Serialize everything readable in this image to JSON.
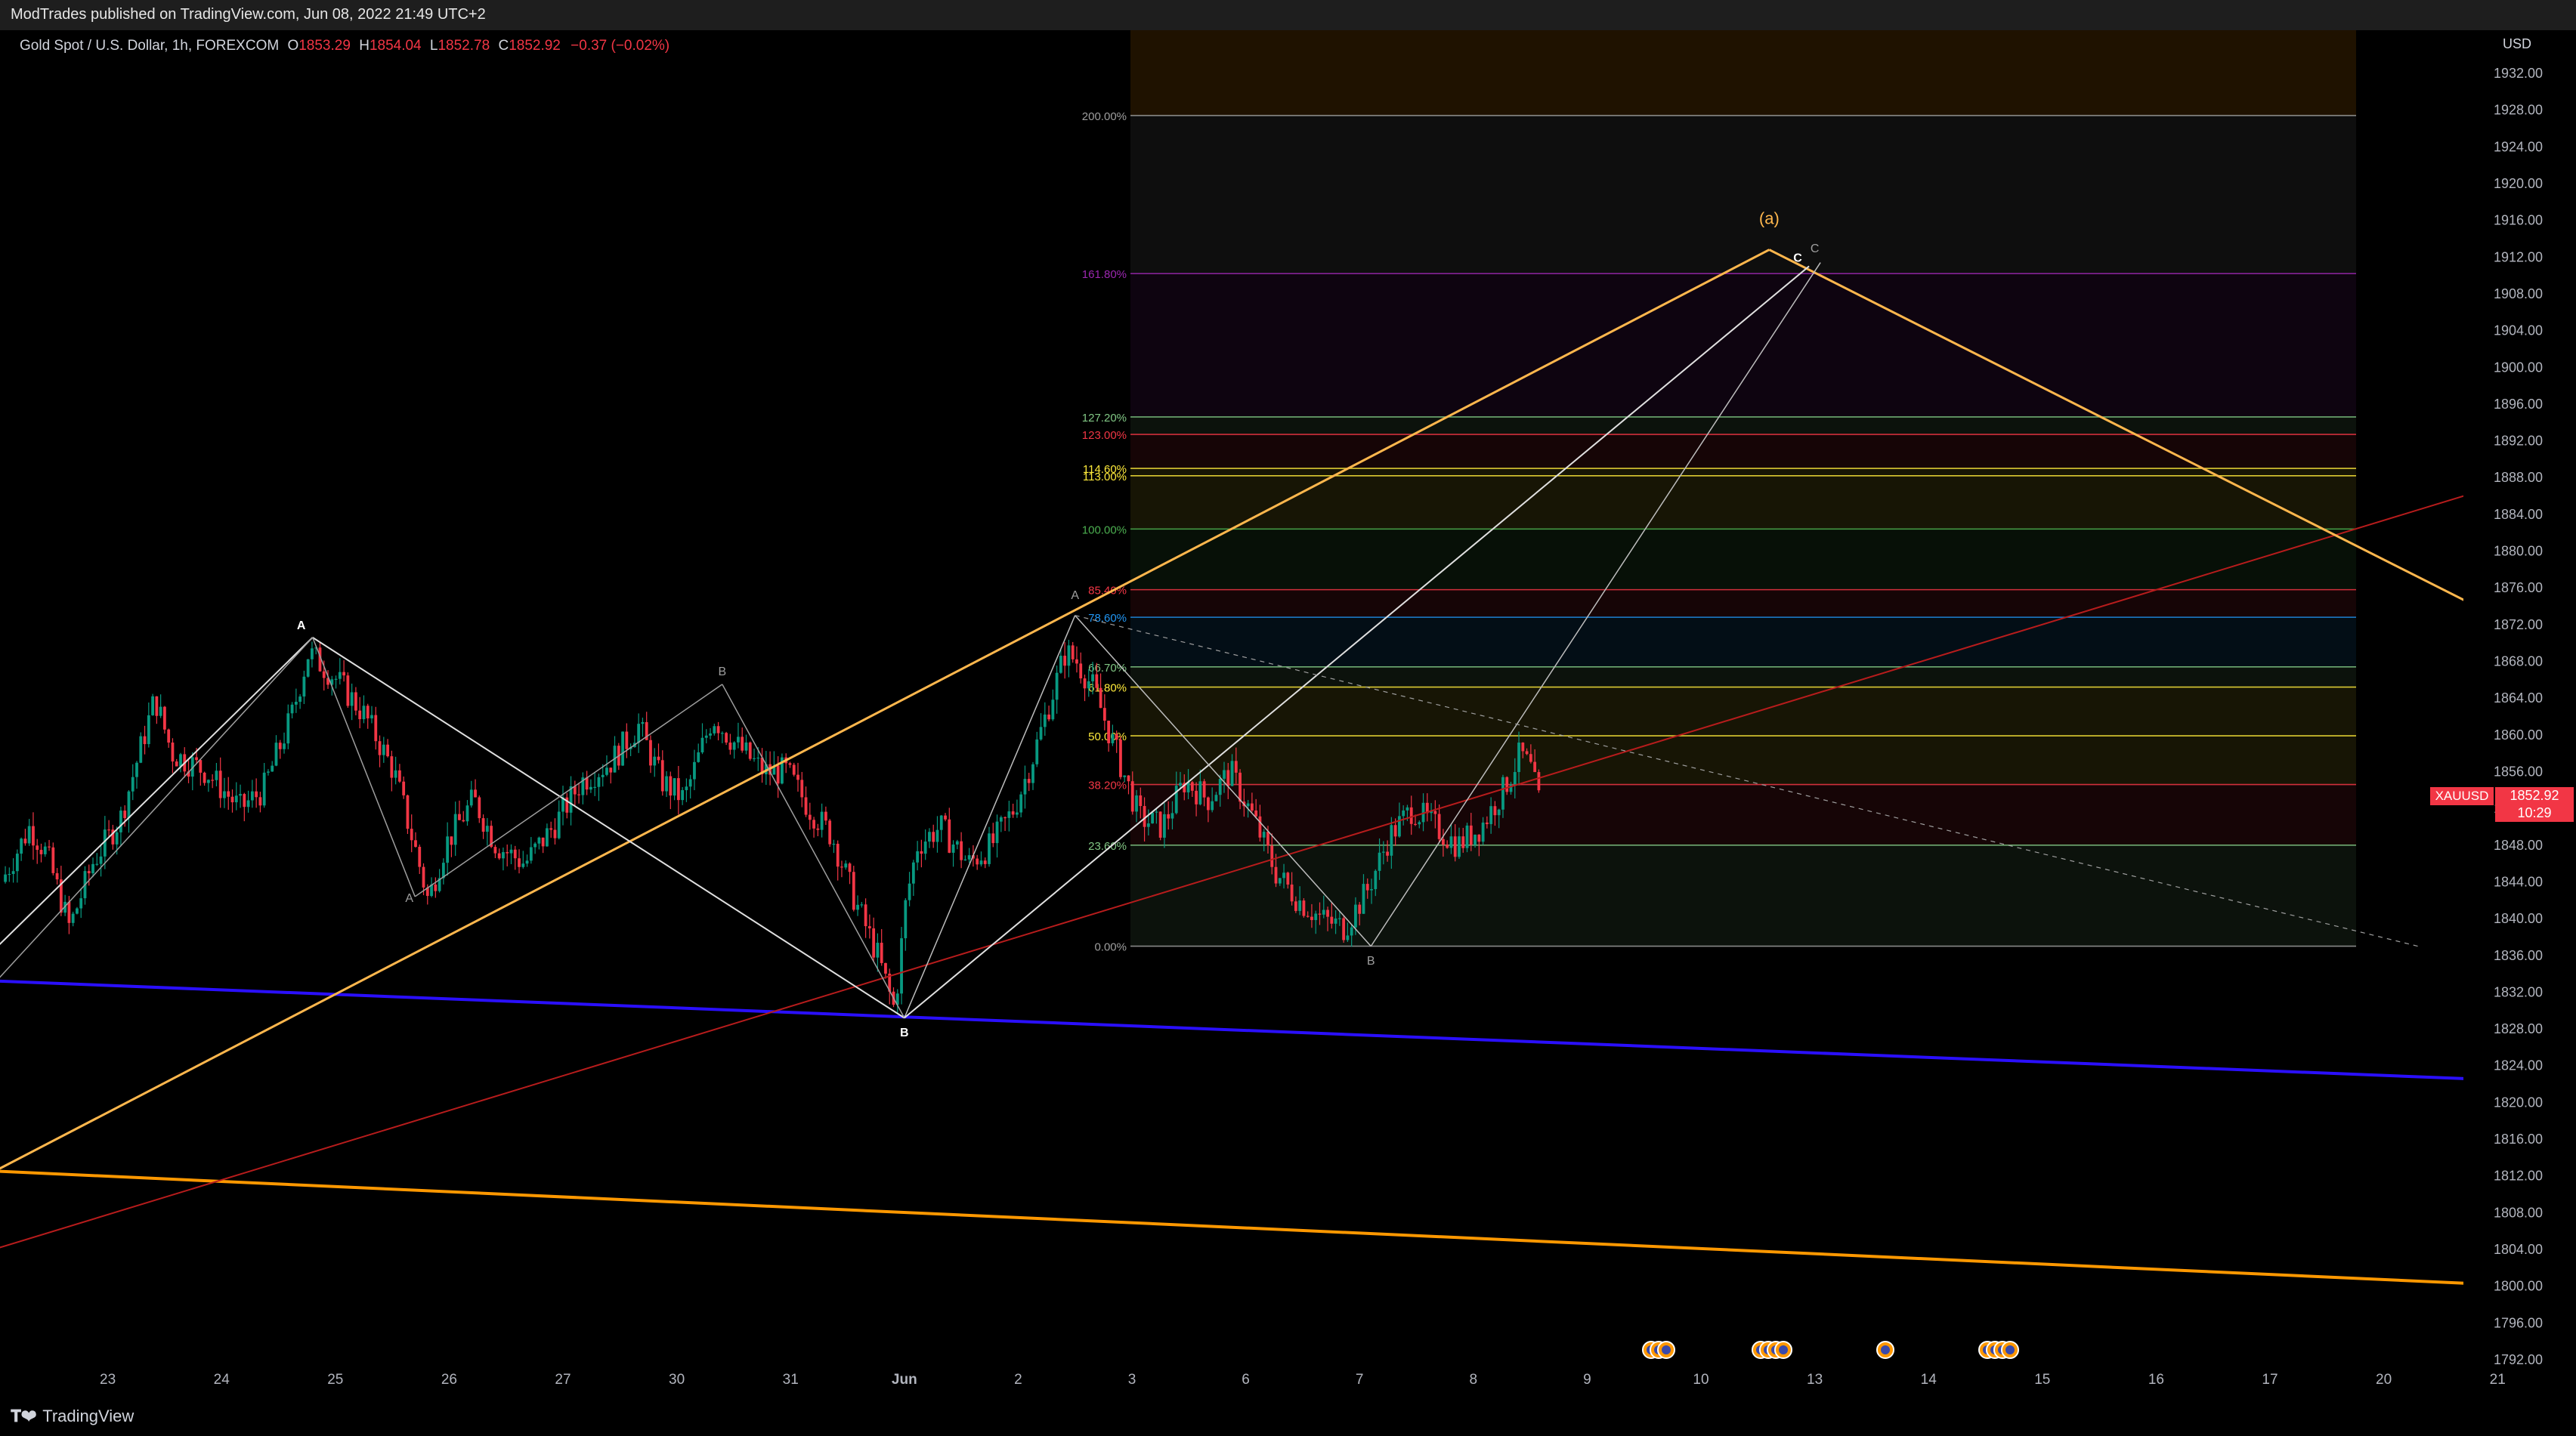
{
  "header": {
    "published": "ModTrades published on TradingView.com, Jun 08, 2022 21:49 UTC+2"
  },
  "legend": {
    "title": "Gold Spot / U.S. Dollar, 1h, FOREXCOM",
    "o_label": "O",
    "o_value": "1853.29",
    "h_label": "H",
    "h_value": "1854.04",
    "l_label": "L",
    "l_value": "1852.78",
    "c_label": "C",
    "c_value": "1852.92",
    "change": "−0.37 (−0.02%)"
  },
  "axis": {
    "currency": "USD",
    "symbol": "XAUUSD",
    "last_price": "1852.92",
    "countdown": "10:29"
  },
  "footer": {
    "brand": "TradingView"
  },
  "colors": {
    "background": "#000000",
    "up_candle": "#089981",
    "down_candle": "#f23645",
    "orange_line": "#ffb74d",
    "blue_line": "#2a0fff",
    "red_line": "#b71c1c",
    "white_line": "#e0e0e0"
  },
  "chart_data": {
    "type": "line",
    "title": "Gold Spot / U.S. Dollar, 1h, FOREXCOM",
    "xlabel": "",
    "ylabel": "",
    "ylim": [
      1790,
      1934
    ],
    "y_ticks": [
      1792,
      1796,
      1800,
      1804,
      1808,
      1812,
      1816,
      1820,
      1824,
      1828,
      1832,
      1836,
      1840,
      1844,
      1848,
      1852,
      1856,
      1860,
      1864,
      1868,
      1872,
      1876,
      1880,
      1884,
      1888,
      1892,
      1896,
      1900,
      1904,
      1908,
      1912,
      1916,
      1920,
      1924,
      1928,
      1932
    ],
    "x_ticks": [
      {
        "label": "23",
        "x": 1
      },
      {
        "label": "24",
        "x": 2
      },
      {
        "label": "25",
        "x": 3
      },
      {
        "label": "26",
        "x": 4
      },
      {
        "label": "27",
        "x": 5
      },
      {
        "label": "30",
        "x": 6
      },
      {
        "label": "31",
        "x": 7
      },
      {
        "label": "Jun",
        "x": 8,
        "bold": true
      },
      {
        "label": "2",
        "x": 9
      },
      {
        "label": "3",
        "x": 10
      },
      {
        "label": "6",
        "x": 11
      },
      {
        "label": "7",
        "x": 12
      },
      {
        "label": "8",
        "x": 13
      },
      {
        "label": "9",
        "x": 14
      },
      {
        "label": "10",
        "x": 15
      },
      {
        "label": "13",
        "x": 16
      },
      {
        "label": "14",
        "x": 17
      },
      {
        "label": "15",
        "x": 18
      },
      {
        "label": "16",
        "x": 19
      },
      {
        "label": "17",
        "x": 20
      },
      {
        "label": "20",
        "x": 21
      },
      {
        "label": "21",
        "x": 22
      }
    ],
    "price_series": {
      "name": "XAUUSD",
      "points": [
        [
          0.1,
          1844
        ],
        [
          0.35,
          1850
        ],
        [
          0.5,
          1847
        ],
        [
          0.7,
          1839
        ],
        [
          0.9,
          1846
        ],
        [
          1.15,
          1851
        ],
        [
          1.45,
          1864
        ],
        [
          1.6,
          1858
        ],
        [
          1.9,
          1856
        ],
        [
          2.2,
          1852
        ],
        [
          2.4,
          1854
        ],
        [
          2.65,
          1862
        ],
        [
          2.8,
          1869
        ],
        [
          3.05,
          1866
        ],
        [
          3.3,
          1862
        ],
        [
          3.55,
          1856
        ],
        [
          3.75,
          1847
        ],
        [
          3.85,
          1842
        ],
        [
          4.0,
          1848
        ],
        [
          4.25,
          1853
        ],
        [
          4.45,
          1848
        ],
        [
          4.7,
          1846
        ],
        [
          4.95,
          1850
        ],
        [
          5.2,
          1855
        ],
        [
          5.45,
          1857
        ],
        [
          5.7,
          1861
        ],
        [
          5.9,
          1855
        ],
        [
          6.1,
          1853
        ],
        [
          6.35,
          1862
        ],
        [
          6.55,
          1859
        ],
        [
          6.8,
          1856
        ],
        [
          7.0,
          1856
        ],
        [
          7.2,
          1852
        ],
        [
          7.4,
          1849
        ],
        [
          7.6,
          1842
        ],
        [
          7.8,
          1836
        ],
        [
          7.95,
          1830
        ],
        [
          8.05,
          1842
        ],
        [
          8.15,
          1848
        ],
        [
          8.35,
          1850
        ],
        [
          8.6,
          1846
        ],
        [
          8.8,
          1848
        ],
        [
          9.0,
          1852
        ],
        [
          9.15,
          1857
        ],
        [
          9.3,
          1863
        ],
        [
          9.45,
          1869
        ],
        [
          9.55,
          1868
        ],
        [
          9.7,
          1865
        ],
        [
          9.9,
          1858
        ],
        [
          10.1,
          1851
        ],
        [
          10.3,
          1850
        ],
        [
          10.5,
          1855
        ],
        [
          10.7,
          1853
        ],
        [
          10.9,
          1856
        ],
        [
          11.1,
          1851
        ],
        [
          11.3,
          1845
        ],
        [
          11.5,
          1842
        ],
        [
          11.7,
          1840
        ],
        [
          11.9,
          1839
        ],
        [
          12.1,
          1843
        ],
        [
          12.3,
          1849
        ],
        [
          12.5,
          1852
        ],
        [
          12.7,
          1850
        ],
        [
          12.9,
          1848
        ],
        [
          13.1,
          1850
        ],
        [
          13.3,
          1854
        ],
        [
          13.45,
          1858
        ],
        [
          13.55,
          1856
        ],
        [
          13.6,
          1852.9
        ]
      ]
    },
    "fib_retracement": {
      "levels": [
        {
          "label": "0.00%",
          "price": 1837.0,
          "color": "#9e9e9e"
        },
        {
          "label": "23.60%",
          "price": 1848.0,
          "color": "#81c784"
        },
        {
          "label": "38.20%",
          "price": 1854.6,
          "color": "#f23645"
        },
        {
          "label": "50.00%",
          "price": 1859.9,
          "color": "#ffeb3b"
        },
        {
          "label": "61.80%",
          "price": 1865.2,
          "color": "#ffeb3b"
        },
        {
          "label": "66.70%",
          "price": 1867.4,
          "color": "#81c784"
        },
        {
          "label": "78.60%",
          "price": 1872.8,
          "color": "#2196f3"
        },
        {
          "label": "85.40%",
          "price": 1875.8,
          "color": "#f23645"
        },
        {
          "label": "100.00%",
          "price": 1882.4,
          "color": "#4caf50"
        },
        {
          "label": "113.00%",
          "price": 1888.2,
          "color": "#ffeb3b"
        },
        {
          "label": "114.60%",
          "price": 1889.0,
          "color": "#ffeb3b"
        },
        {
          "label": "123.00%",
          "price": 1892.7,
          "color": "#f23645"
        },
        {
          "label": "127.20%",
          "price": 1894.6,
          "color": "#81c784"
        },
        {
          "label": "161.80%",
          "price": 1910.2,
          "color": "#9c27b0"
        },
        {
          "label": "200.00%",
          "price": 1927.4,
          "color": "#9e9e9e"
        }
      ]
    },
    "wave_labels": [
      {
        "text": "A",
        "x": 2.7,
        "price": 1871.5,
        "bold": true
      },
      {
        "text": "A",
        "x": 3.65,
        "price": 1841.8,
        "bold": false
      },
      {
        "text": "B",
        "x": 6.4,
        "price": 1866.5,
        "bold": false
      },
      {
        "text": "B",
        "x": 8.0,
        "price": 1827.2,
        "bold": true
      },
      {
        "text": "A",
        "x": 9.5,
        "price": 1874.8,
        "bold": false
      },
      {
        "text": "B",
        "x": 12.1,
        "price": 1835.0,
        "bold": false
      },
      {
        "text": "C",
        "x": 15.85,
        "price": 1911.5,
        "bold": true
      },
      {
        "text": "C",
        "x": 16.0,
        "price": 1912.5,
        "bold": false
      },
      {
        "text": "(a)",
        "x": 15.6,
        "price": 1915.6,
        "bold": false
      }
    ]
  }
}
